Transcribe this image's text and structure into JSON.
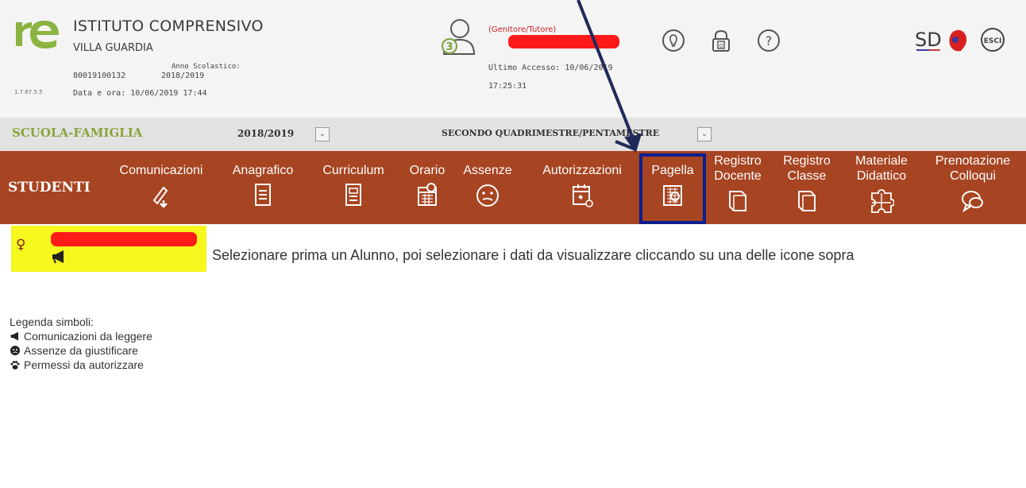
{
  "header": {
    "school_name": "ISTITUTO COMPRENSIVO",
    "school_city": "VILLA GUARDIA",
    "version": "1.7.67.5.5",
    "school_code": "80019100132",
    "year_label": "Anno Scolastico:",
    "year_value": "2018/2019",
    "datetime": "Data e ora: 10/06/2019 17:44",
    "user_role": "(Genitore/Tutore)",
    "user_badge": "3",
    "last_access": "Ultimo Accesso: 10/06/2019",
    "last_access_time": "17:25:31",
    "icons": [
      "lightbulb-icon",
      "lock-icon",
      "help-icon"
    ],
    "brand_logo": "SD",
    "exit_label": "ESCI"
  },
  "selector_bar": {
    "title": "SCUOLA-FAMIGLIA",
    "year": "2018/2019",
    "period": "SECONDO QUADRIMESTRE/PENTAMESTRE"
  },
  "nav": {
    "section": "STUDENTI",
    "items": [
      {
        "line1": "Comunicazioni",
        "line2": "",
        "icon": "megaphone-icon"
      },
      {
        "line1": "Anagrafico",
        "line2": "",
        "icon": "id-card-icon"
      },
      {
        "line1": "Curriculum",
        "line2": "",
        "icon": "document-icon"
      },
      {
        "line1": "Orario",
        "line2": "",
        "icon": "calendar-icon"
      },
      {
        "line1": "Assenze",
        "line2": "",
        "icon": "face-icon"
      },
      {
        "line1": "Autorizzazioni",
        "line2": "",
        "icon": "calendar-check-icon"
      },
      {
        "line1": "Pagella",
        "line2": "",
        "icon": "report-card-icon"
      },
      {
        "line1": "Registro",
        "line2": "Docente",
        "icon": "book-icon"
      },
      {
        "line1": "Registro",
        "line2": "Classe",
        "icon": "book-icon"
      },
      {
        "line1": "Materiale",
        "line2": "Didattico",
        "icon": "puzzle-icon"
      },
      {
        "line1": "Prenotazione",
        "line2": "Colloqui",
        "icon": "chat-icon"
      }
    ]
  },
  "main": {
    "gender_symbol": "♀",
    "instruction": "Selezionare prima un Alunno, poi selezionare i dati da visualizzare cliccando su una delle icone sopra"
  },
  "legend": {
    "title": "Legenda simboli:",
    "items": [
      {
        "label": "Comunicazioni da leggere",
        "icon": "megaphone-icon"
      },
      {
        "label": "Assenze da giustificare",
        "icon": "face-icon"
      },
      {
        "label": "Permessi da autorizzare",
        "icon": "paw-icon"
      }
    ]
  },
  "colors": {
    "nav_bar": "#a74421",
    "school_title": "#8aa33a",
    "student_highlight": "#f5f71e",
    "annotation_box": "#0a1f8f",
    "redaction": "#ff1a1a"
  }
}
